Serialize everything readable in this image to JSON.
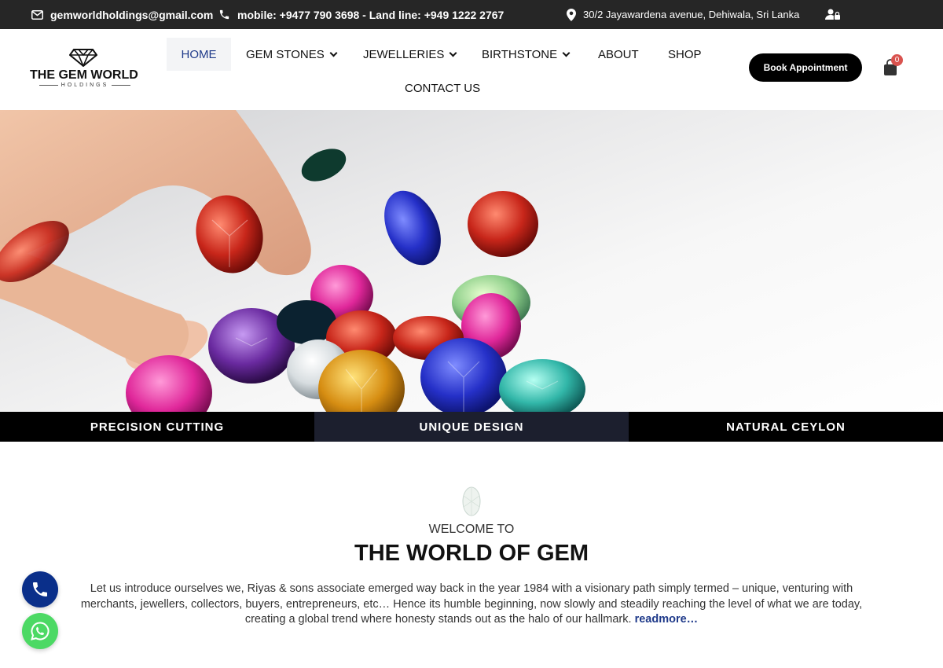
{
  "topbar": {
    "email": "gemworldholdings@gmail.com",
    "phone": "mobile: +9477 790 3698 - Land line: +949 1222 2767",
    "address": "30/2 Jayawardena avenue, Dehiwala, Sri Lanka"
  },
  "logo": {
    "name": "THE GEM WORLD",
    "sub": "HOLDINGS"
  },
  "nav": {
    "home": "HOME",
    "gem_stones": "GEM STONES",
    "jewelleries": "JEWELLERIES",
    "birthstone": "BIRTHSTONE",
    "about": "ABOUT",
    "shop": "SHOP",
    "contact": "CONTACT US"
  },
  "header": {
    "book_label": "Book Appointment",
    "cart_count": "0"
  },
  "features": [
    "PRECISION CUTTING",
    "UNIQUE DESIGN",
    "NATURAL CEYLON"
  ],
  "welcome": {
    "kicker": "WELCOME TO",
    "title": "THE WORLD OF GEM",
    "text": "Let us introduce ourselves we, Riyas & sons associate emerged way back in the year 1984 with a visionary path simply termed – unique, venturing with merchants, jewellers, collectors, buyers, entrepreneurs, etc… Hence its humble beginning, now slowly and steadily reaching the level of what we are today, creating a global trend where honesty stands out as the halo of our hallmark.",
    "readmore": "readmore…"
  },
  "colors": {
    "topbar": "#262626",
    "accent": "#1f3a8a",
    "strip": "#000000",
    "strip_active": "#1c1f2e",
    "whatsapp": "#4cd964"
  }
}
